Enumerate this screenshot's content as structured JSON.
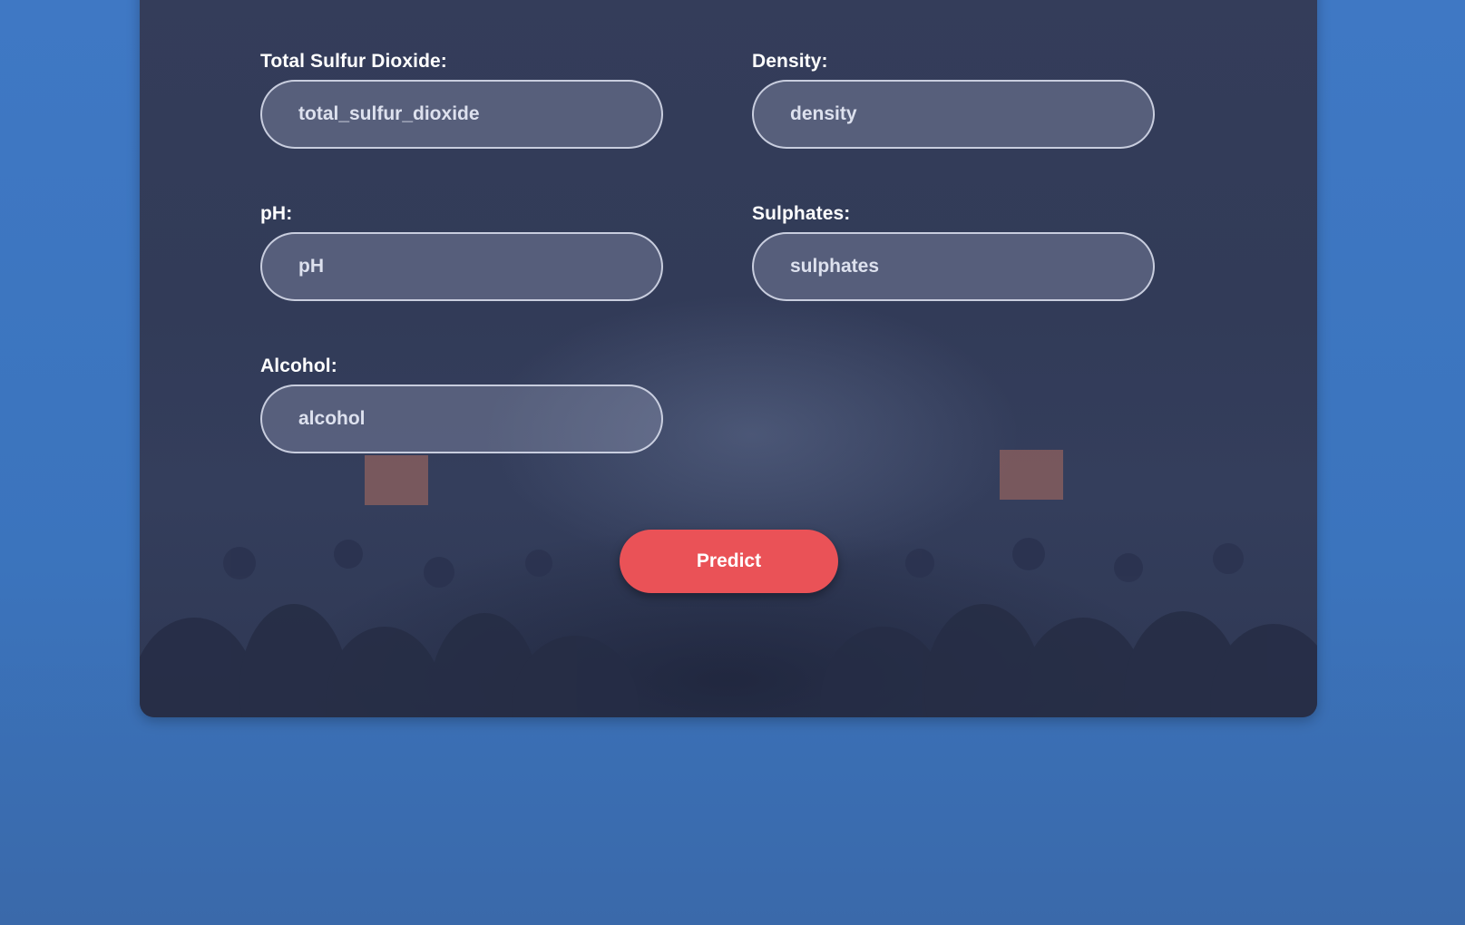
{
  "form": {
    "fields": [
      {
        "label": "Total Sulfur Dioxide:",
        "placeholder": "total_sulfur_dioxide",
        "value": ""
      },
      {
        "label": "Density:",
        "placeholder": "density",
        "value": ""
      },
      {
        "label": "pH:",
        "placeholder": "pH",
        "value": ""
      },
      {
        "label": "Sulphates:",
        "placeholder": "sulphates",
        "value": ""
      },
      {
        "label": "Alcohol:",
        "placeholder": "alcohol",
        "value": ""
      }
    ],
    "submit_label": "Predict"
  },
  "colors": {
    "page_background": "#3f78c4",
    "card_background": "#343d5a",
    "button": "#ea5257"
  }
}
